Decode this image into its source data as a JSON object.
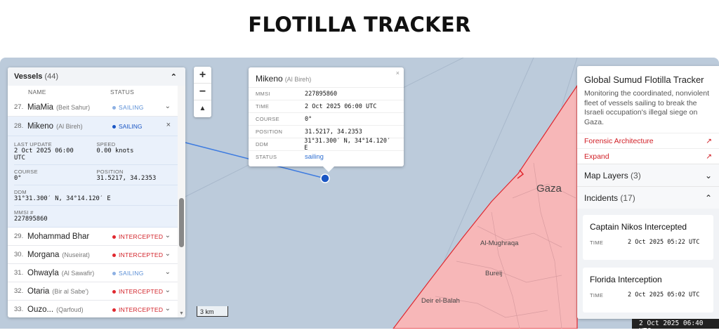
{
  "page": {
    "title": "FLOTILLA TRACKER"
  },
  "vessels": {
    "header_label": "Vessels",
    "count": "(44)",
    "col_name": "NAME",
    "col_status": "STATUS",
    "rows_before": [
      {
        "num": "27.",
        "name": "MiaMia",
        "sub": "(Beit Sahur)",
        "status": "SAILING",
        "kind": "sailing"
      }
    ],
    "selected": {
      "num": "28.",
      "name": "Mikeno",
      "sub": "(Al Bireh)",
      "status": "SAILING",
      "last_update_label": "LAST UPDATE",
      "last_update": "2 Oct 2025 06:00",
      "last_update_tz": "UTC",
      "speed_label": "SPEED",
      "speed": "0.00 knots",
      "course_label": "COURSE",
      "course": "0°",
      "position_label": "POSITION",
      "position": "31.5217, 34.2353",
      "ddm_label": "DDM",
      "ddm": "31°31.300′ N, 34°14.120′ E",
      "mmsi_label": "MMSI #",
      "mmsi": "227895860"
    },
    "rows_after": [
      {
        "num": "29.",
        "name": "Mohammad Bhar",
        "sub": "",
        "status": "INTERCEPTED",
        "kind": "int"
      },
      {
        "num": "30.",
        "name": "Morgana",
        "sub": "(Nuseirat)",
        "status": "INTERCEPTED",
        "kind": "int"
      },
      {
        "num": "31.",
        "name": "Ohwayla",
        "sub": "(Al Sawafir)",
        "status": "SAILING",
        "kind": "sailing"
      },
      {
        "num": "32.",
        "name": "Otaria",
        "sub": "(Bir al Sabe')",
        "status": "INTERCEPTED",
        "kind": "int"
      },
      {
        "num": "33.",
        "name": "Ouzo...",
        "sub": "(Qarfoud)",
        "status": "INTERCEPTED",
        "kind": "int"
      }
    ]
  },
  "map": {
    "scale": "3 km",
    "zoom_in": "+",
    "zoom_out": "−",
    "compass": "▲",
    "labels": {
      "gaza": "Gaza",
      "mughraqa": "Al-Mughraqa",
      "bureij": "Bureij",
      "deir": "Deir el-Balah"
    }
  },
  "popup": {
    "name": "Mikeno",
    "sub": "(Al Bireh)",
    "close": "×",
    "rows": [
      {
        "k": "MMSI",
        "v": "227895860"
      },
      {
        "k": "TIME",
        "v": "2 Oct 2025 06:00 UTC"
      },
      {
        "k": "COURSE",
        "v": "0°"
      },
      {
        "k": "POSITION",
        "v": "31.5217, 34.2353"
      },
      {
        "k": "DDM",
        "v": "31°31.300′ N, 34°14.120′ E"
      },
      {
        "k": "STATUS",
        "v": "sailing"
      }
    ]
  },
  "info": {
    "title": "Global Sumud Flotilla Tracker",
    "description": "Monitoring the coordinated, nonviolent fleet of vessels sailing to break the Israeli occupation's illegal siege on Gaza.",
    "link1": "Forensic Architecture",
    "link2": "Expand",
    "layers_label": "Map Layers",
    "layers_count": "(3)",
    "incidents_label": "Incidents",
    "incidents_count": "(17)",
    "incidents": [
      {
        "title": "Captain Nikos Intercepted",
        "time_label": "TIME",
        "time": "2 Oct 2025 05:22 UTC"
      },
      {
        "title": "Florida Interception",
        "time_label": "TIME",
        "time": "2 Oct 2025 05:02 UTC"
      }
    ]
  },
  "clock": "2 Oct 2025 06:40 UTC",
  "colors": {
    "sea": "#bccbdb",
    "land": "#f7b7b8",
    "border": "#e0282f",
    "track": "#3d7be0"
  }
}
